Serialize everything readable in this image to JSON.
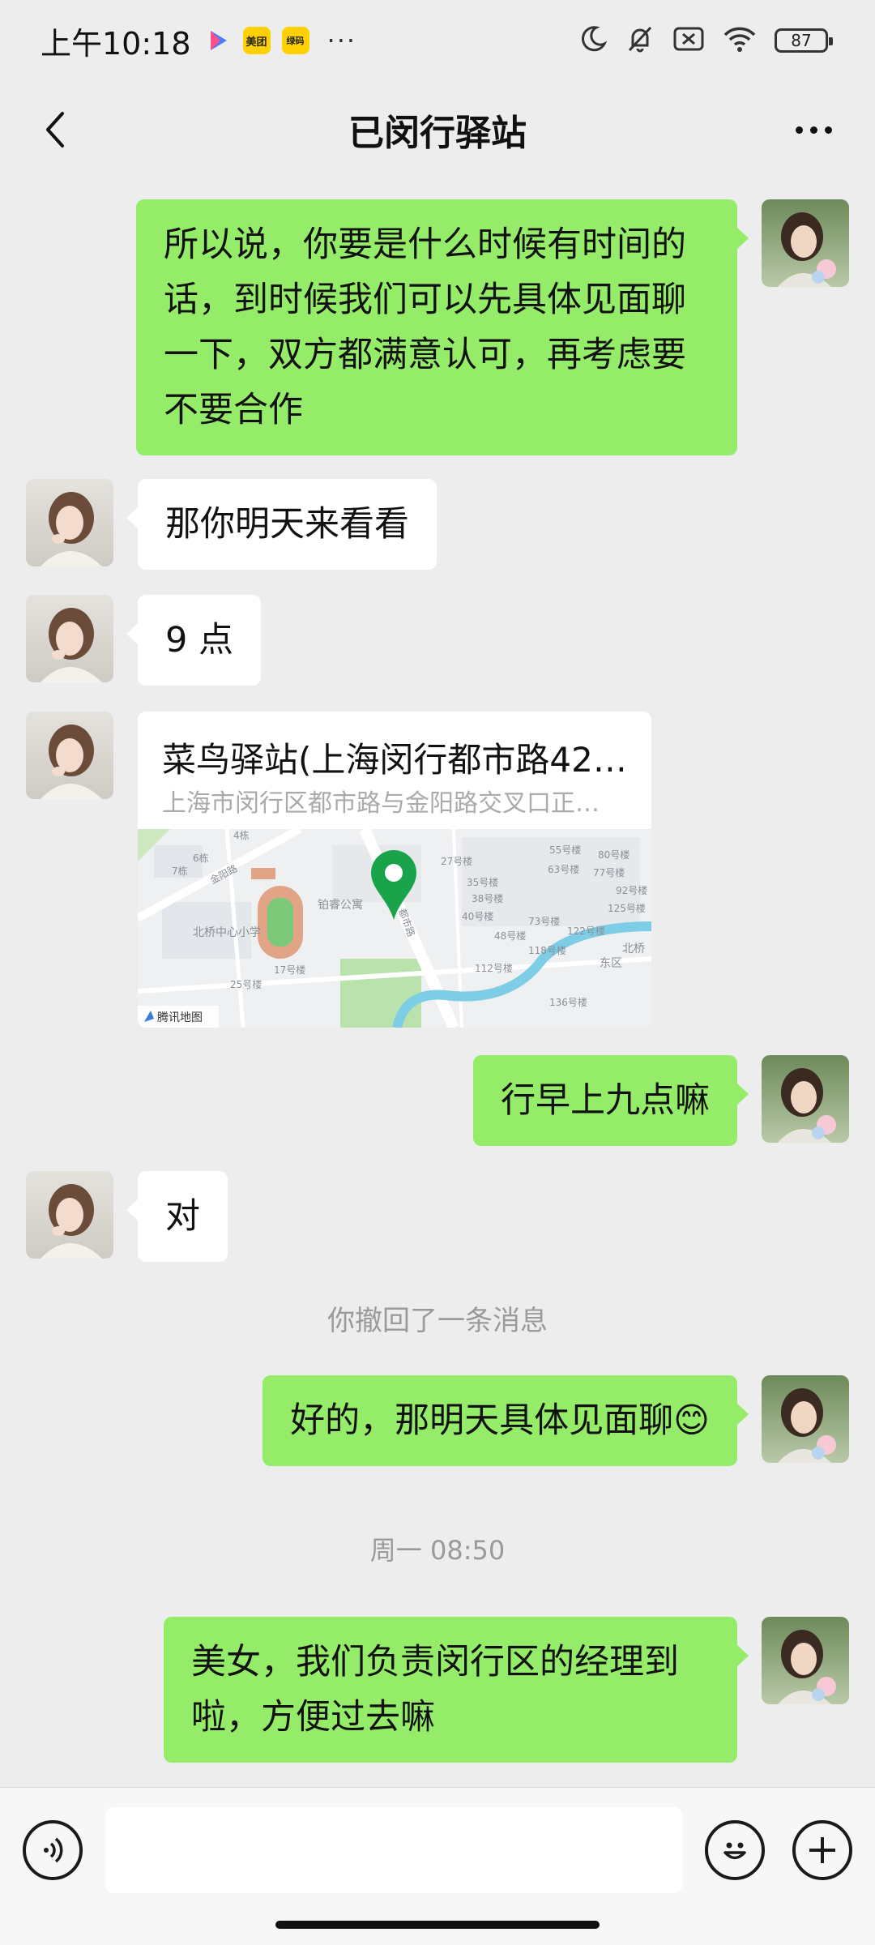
{
  "status_bar": {
    "time": "上午10:18",
    "badges": [
      "▶",
      "美团",
      "绿码"
    ],
    "more_dots": "···",
    "battery": "87"
  },
  "nav": {
    "title": "已闵行驿站"
  },
  "messages": [
    {
      "sender": "me",
      "text": "所以说，你要是什么时候有时间的话，到时候我们可以先具体见面聊一下，双方都满意认可，再考虑要不要合作"
    },
    {
      "sender": "other",
      "text": "那你明天来看看"
    },
    {
      "sender": "other",
      "text": "9 点"
    },
    {
      "sender": "me",
      "text": "行早上九点嘛"
    },
    {
      "sender": "other",
      "text": "对"
    },
    {
      "sender": "me",
      "text": "好的，那明天具体见面聊😊"
    },
    {
      "sender": "me",
      "text": "美女，我们负责闵行区的经理到啦，方便过去嘛"
    }
  ],
  "location_card": {
    "title": "菜鸟驿站(上海闵行都市路42…",
    "address": "上海市闵行区都市路与金阳路交叉口正…",
    "map_provider": "腾讯地图",
    "map_labels": [
      "金阳路",
      "北桥中心小学",
      "铂睿公寓",
      "都市路",
      "17号楼",
      "25号楼",
      "4栋",
      "7栋",
      "6栋",
      "27号楼",
      "35号楼",
      "38号楼",
      "40号楼",
      "48号楼",
      "73号楼",
      "118号楼",
      "112号楼",
      "122号楼",
      "125号楼",
      "136号楼",
      "55号楼",
      "63号楼",
      "77号楼",
      "80号楼",
      "92号楼",
      "北桥",
      "东区"
    ]
  },
  "system": {
    "recalled": "你撤回了一条消息",
    "timestamp": "周一 08:50"
  },
  "input": {
    "placeholder": ""
  },
  "colors": {
    "my_bubble": "#95ec69",
    "other_bubble": "#ffffff",
    "background": "#ededed",
    "map_pin": "#19a34a"
  }
}
